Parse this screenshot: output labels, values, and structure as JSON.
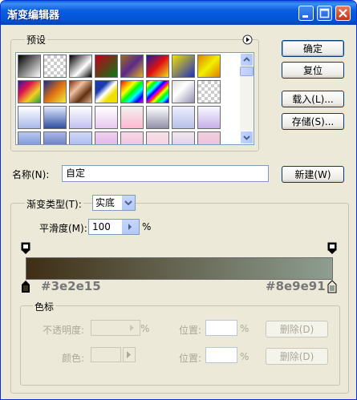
{
  "window": {
    "title": "渐变编辑器"
  },
  "buttons": {
    "ok": "确定",
    "reset": "复位",
    "load": "载入(L)...",
    "save": "存储(S)...",
    "new": "新建(W)"
  },
  "presets": {
    "label": "预设",
    "swatches": [
      "linear-gradient(135deg,#000,#fff)",
      "repeating-conic-gradient(#ccc 0 25%, #fff 0 50%) 0 0/8px 8px",
      "linear-gradient(135deg,#000,#fff 60%, #000)",
      "linear-gradient(135deg,#c0001a,#0a7a1a)",
      "linear-gradient(135deg,#a06a20,#5a2a8a,#e0b020)",
      "linear-gradient(135deg,#1a1aa0,#e01010,#f0e020)",
      "linear-gradient(135deg,#f0e000,#2030c0)",
      "linear-gradient(135deg,#e08000,#f0f000,#e08000)",
      "linear-gradient(135deg,#2a1aa0,#e01050,#f0d020,#20a040)",
      "linear-gradient(135deg,#1a2a90,#e07010,#f0f040)",
      "linear-gradient(135deg,#803010,#f0c0a0,#603010,#e0b090)",
      "linear-gradient(135deg,#1a3ab0 30%,#fff 50%,#f0e000 70%)",
      "linear-gradient(135deg,#f00,#f80,#ff0,#0f0,#0ff,#00f,#f0f)",
      "repeating-linear-gradient(135deg,#f00 0,#ff0 4px,#0f0 8px,#0ff 12px,#00f 16px,#f0f 20px)",
      "linear-gradient(135deg,#e0e0e0,#fff 40%,#9090b0)",
      "repeating-conic-gradient(#ccc 0 25%, #fff 0 50%) 0 0/8px 8px",
      "linear-gradient(#fff,#a8b8e8)",
      "linear-gradient(#e0e8ff,#3050a0)",
      "linear-gradient(#fff,#c0c0f0)",
      "linear-gradient(#fff,#e8c8f0)",
      "linear-gradient(#f0f0f0,#ffb8d0)",
      "linear-gradient(#fff,#9090a8)",
      "linear-gradient(#eef,#b8c0e8)",
      "linear-gradient(#f8f8ff,#c8b0e8)",
      "linear-gradient(#b8c8f0,#5878c8)",
      "linear-gradient(#aab8e8,#4058a8)",
      "linear-gradient(#d0d8f8,#98a8e8)",
      "linear-gradient(#f0d0f0,#d8a8e0)",
      "linear-gradient(#f8d8e8,#e8b8d0)",
      "linear-gradient(#f8e0e8,#f0c8d8)",
      "linear-gradient(#f0e8f0,#d8c0e0)",
      "linear-gradient(#f0d0e0,#e8b8d0)"
    ]
  },
  "name_field": {
    "label": "名称(N):",
    "value": "自定"
  },
  "gradient": {
    "type_label": "渐变类型(T):",
    "type_value": "实底",
    "smoothness_label": "平滑度(M):",
    "smoothness_value": "100",
    "percent": "%",
    "start_color": "#3e2e15",
    "end_color": "#8e9e91"
  },
  "stops": {
    "group_label": "色标",
    "opacity_label": "不透明度:",
    "opacity_unit": "%",
    "position_label_1": "位置:",
    "position_unit_1": "%",
    "delete_1": "删除(D)",
    "color_label": "颜色:",
    "position_label_2": "位置:",
    "position_unit_2": "%",
    "delete_2": "删除(D)"
  }
}
